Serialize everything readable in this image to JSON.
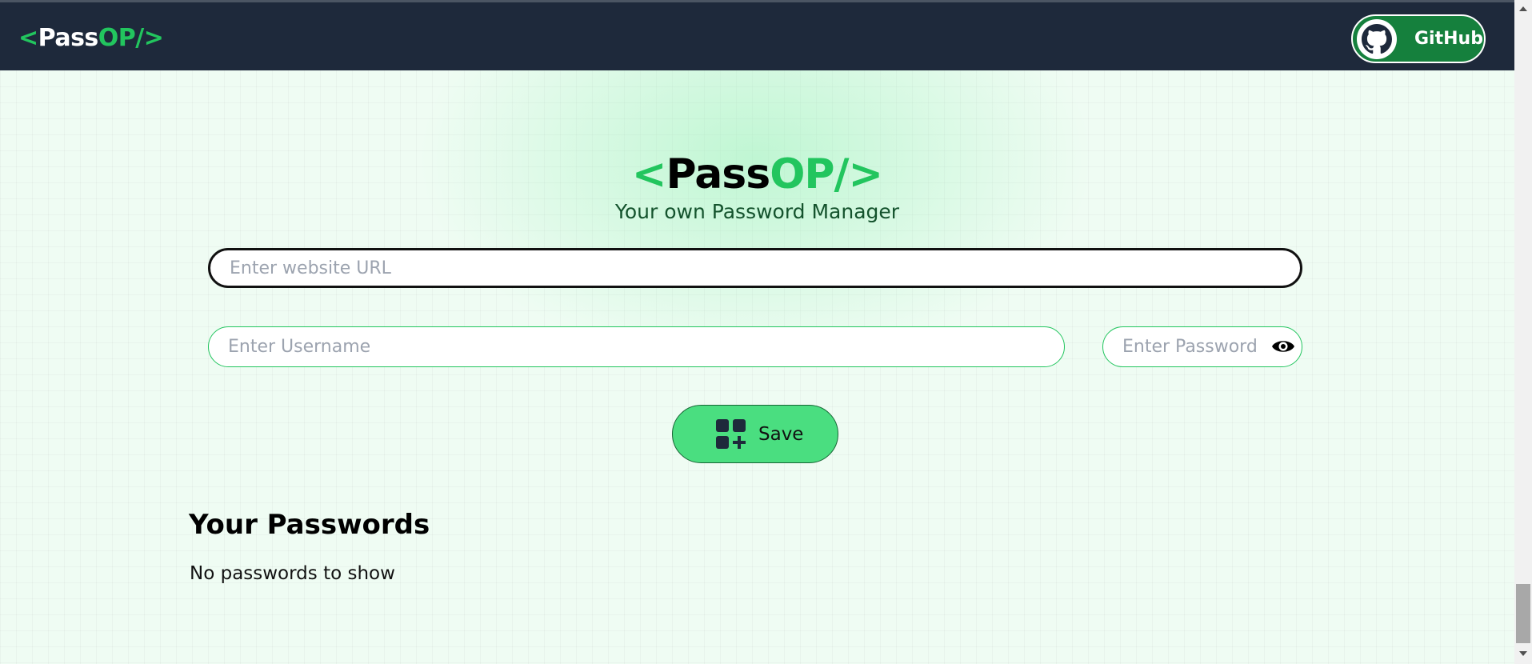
{
  "navbar": {
    "logo": {
      "open": "<",
      "pass": "Pass",
      "op": "OP/>"
    },
    "github_label": "GitHub"
  },
  "hero": {
    "title": {
      "open": "<",
      "pass": "Pass",
      "op": "OP/>"
    },
    "subtitle": "Your own Password Manager"
  },
  "form": {
    "url_placeholder": "Enter website URL",
    "username_placeholder": "Enter Username",
    "password_placeholder": "Enter Password",
    "save_label": "Save"
  },
  "passwords": {
    "heading": "Your Passwords",
    "empty_message": "No passwords to show"
  },
  "colors": {
    "navbar_bg": "#1e293b",
    "accent_green": "#22c55e",
    "save_button": "#4ade80",
    "github_button": "#15803d",
    "page_bg": "#effcf3"
  },
  "icons": {
    "github": "github-icon",
    "eye": "eye-icon",
    "save": "grid-plus-icon"
  }
}
